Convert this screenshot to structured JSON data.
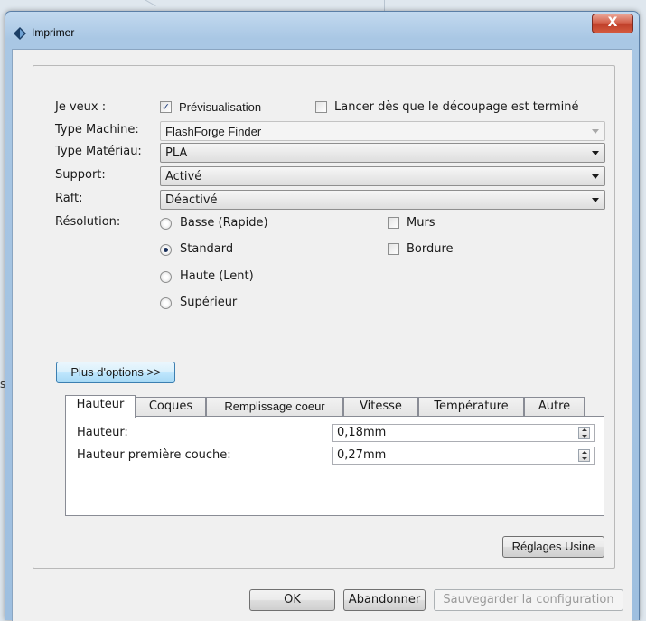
{
  "window": {
    "title": "Imprimer",
    "close_label": "X"
  },
  "background": {
    "side_text": "s"
  },
  "form": {
    "je_veux_label": "Je veux :",
    "preview": {
      "label": "Prévisualisation",
      "checked": true
    },
    "launch_after_slice": {
      "label": "Lancer dès que le découpage est terminé",
      "checked": false
    },
    "machine_type": {
      "label": "Type Machine:",
      "value": "FlashForge Finder",
      "enabled": false
    },
    "material_type": {
      "label": "Type Matériau:",
      "value": "PLA"
    },
    "support": {
      "label": "Support:",
      "value": "Activé"
    },
    "raft": {
      "label": "Raft:",
      "value": "Déactivé"
    },
    "resolution": {
      "label": "Résolution:",
      "options": [
        {
          "label": "Basse (Rapide)",
          "selected": false
        },
        {
          "label": "Standard",
          "selected": true
        },
        {
          "label": "Haute (Lent)",
          "selected": false
        },
        {
          "label": "Supérieur",
          "selected": false
        }
      ]
    },
    "walls": {
      "label": "Murs",
      "checked": false
    },
    "brim": {
      "label": "Bordure",
      "checked": false
    },
    "more_options_label": "Plus d'options >>"
  },
  "tabs": [
    {
      "label": "Hauteur",
      "active": true
    },
    {
      "label": "Coques",
      "active": false
    },
    {
      "label": "Remplissage coeur",
      "active": false
    },
    {
      "label": "Vitesse",
      "active": false
    },
    {
      "label": "Température",
      "active": false
    },
    {
      "label": "Autre",
      "active": false
    }
  ],
  "height_tab": {
    "layer_height": {
      "label": "Hauteur:",
      "value": "0,18mm"
    },
    "first_layer_height": {
      "label": "Hauteur première couche:",
      "value": "0,27mm"
    }
  },
  "factory_reset_label": "Réglages Usine",
  "footer": {
    "ok_label": "OK",
    "cancel_label": "Abandonner",
    "save_config_label": "Sauvegarder la configuration"
  },
  "colors": {
    "title_bar": "#a9c7e4",
    "close_button": "#c0402a",
    "client": "#f0f0f0",
    "focus": "#3c7fb1"
  }
}
